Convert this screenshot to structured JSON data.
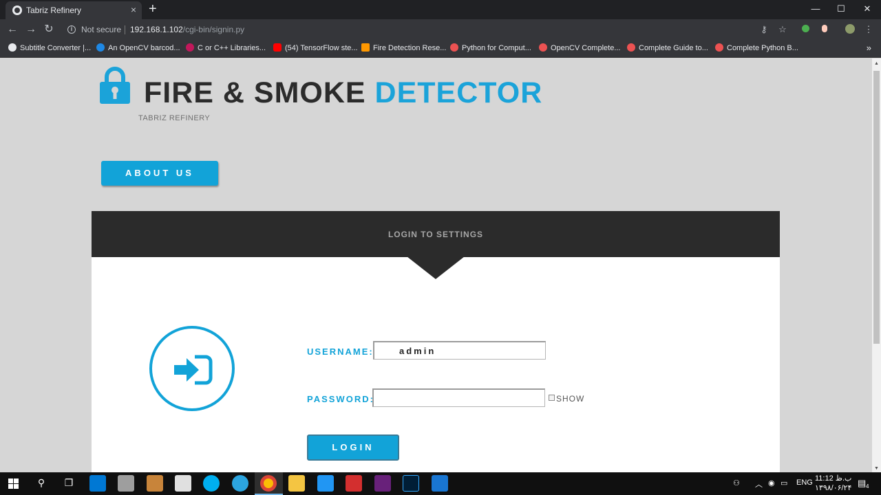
{
  "browser": {
    "tab_title": "Tabriz Refinery",
    "tab_close": "×",
    "new_tab": "+",
    "window_controls": [
      "—",
      "☐",
      "✕"
    ],
    "security_label": "Not secure",
    "url_host": "192.168.1.102",
    "url_path": "/cgi-bin/signin.py",
    "bookmarks": [
      {
        "label": "Subtitle Converter |...",
        "icon": "globe-icon",
        "color": "#e8eaed"
      },
      {
        "label": "An OpenCV barcod...",
        "icon": "p-icon",
        "color": "#1e88e5"
      },
      {
        "label": "C or C++ Libraries...",
        "icon": "raspberry-icon",
        "color": "#c2185b"
      },
      {
        "label": "(54) TensorFlow ste...",
        "icon": "youtube-icon",
        "color": "#ff0000"
      },
      {
        "label": "Fire Detection Rese...",
        "icon": "fire-icon",
        "color": "#ff9800"
      },
      {
        "label": "Python for Comput...",
        "icon": "udemy-icon",
        "color": "#ec5252"
      },
      {
        "label": "OpenCV Complete...",
        "icon": "udemy-icon",
        "color": "#ec5252"
      },
      {
        "label": "Complete Guide to...",
        "icon": "udemy-icon",
        "color": "#ec5252"
      },
      {
        "label": "Complete Python B...",
        "icon": "udemy-icon",
        "color": "#ec5252"
      }
    ],
    "bookmarks_more": "»"
  },
  "header": {
    "title_main": "FIRE & SMOKE ",
    "title_accent": "DETECTOR",
    "subtitle": "TABRIZ REFINERY",
    "accent_color": "#1ba3d9"
  },
  "nav": {
    "about_label": "ABOUT US"
  },
  "login": {
    "panel_title": "LOGIN TO SETTINGS",
    "username_label": "USERNAME:",
    "username_value": "admin",
    "password_label": "PASSWORD:",
    "password_value": "",
    "show_label": "SHOW",
    "login_label": "LOGIN"
  },
  "taskbar": {
    "language": "ENG",
    "time": "11:12 ب.ظ",
    "date": "۱۳۹۸/۰۶/۲۴",
    "notification_count": "4"
  }
}
